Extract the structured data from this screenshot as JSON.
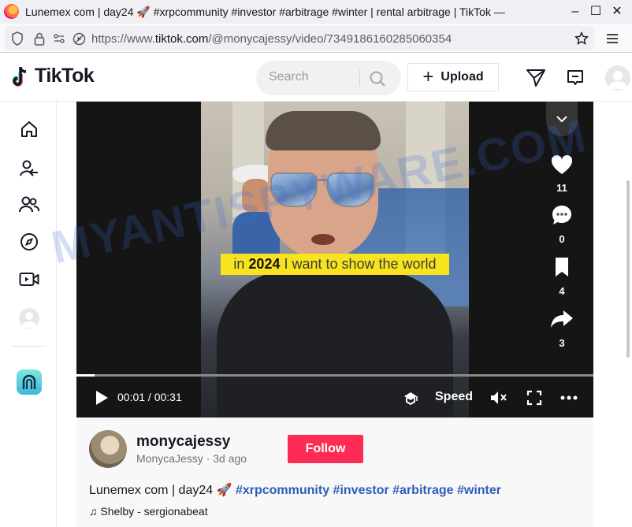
{
  "browser": {
    "tab_title": "Lunemex com | day24 🚀 #xrpcommunity #investor #arbitrage #winter | rental arbitrage | TikTok —",
    "url_prefix": "https://www.",
    "url_domain": "tiktok.com",
    "url_path": "/@monycajessy/video/7349186160285060354"
  },
  "header": {
    "logo_text": "TikTok",
    "search_placeholder": "Search",
    "upload_label": "Upload"
  },
  "video": {
    "caption_pre": "in ",
    "caption_bold": "2024",
    "caption_post": " I want to show the world",
    "time": "00:01 / 00:31",
    "speed_label": "Speed",
    "progress": 0.035
  },
  "actions": {
    "likes": "11",
    "comments": "0",
    "bookmarks": "4",
    "shares": "3"
  },
  "author": {
    "username": "monycajessy",
    "display_name": "MonycaJessy",
    "posted": "3d ago",
    "follow_label": "Follow"
  },
  "description": {
    "text": "Lunemex com | day24 🚀",
    "tags": [
      "#xrpcommunity",
      "#investor",
      "#arbitrage",
      "#winter"
    ]
  },
  "music": {
    "label": "Shelby - sergionabeat"
  },
  "watermark": "MYANTISPYWARE.COM",
  "colors": {
    "accent": "#fe2c55",
    "hashtag": "#2b5db9",
    "caption_bg": "#f7e41e"
  }
}
